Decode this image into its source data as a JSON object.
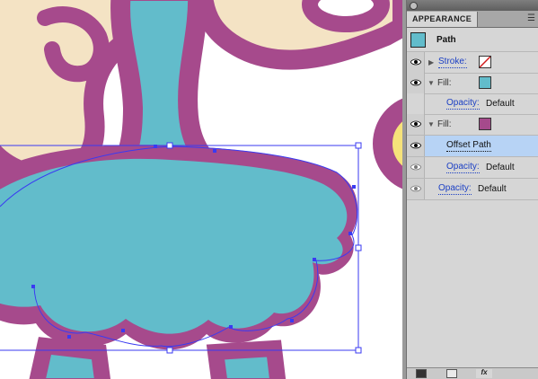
{
  "panel": {
    "tab_title": "APPEARANCE",
    "menu_icon": "panel-menu-icon",
    "header": {
      "label": "Path",
      "swatch_color": "#62bccb"
    },
    "rows": [
      {
        "type": "stroke",
        "label": "Stroke:",
        "swatch": "none"
      },
      {
        "type": "fill",
        "label": "Fill:",
        "swatch_color": "#62bccb"
      },
      {
        "type": "opacity",
        "label": "Opacity:",
        "value": "Default"
      },
      {
        "type": "fill",
        "label": "Fill:",
        "swatch_color": "#a64a8c"
      },
      {
        "type": "effect",
        "label": "Offset Path"
      },
      {
        "type": "opacity",
        "label": "Opacity:",
        "value": "Default"
      },
      {
        "type": "opacity",
        "label": "Opacity:",
        "value": "Default"
      }
    ],
    "bottom_buttons": [
      "new-layer-icon",
      "clear-icon",
      "fx-icon"
    ],
    "fx_label": "fx"
  },
  "colors": {
    "accent_purple": "#a64a8c",
    "teal": "#62bccb",
    "cream": "#f4e3c4",
    "selection_blue": "#3a3af2",
    "yellow": "#f6e27a"
  }
}
